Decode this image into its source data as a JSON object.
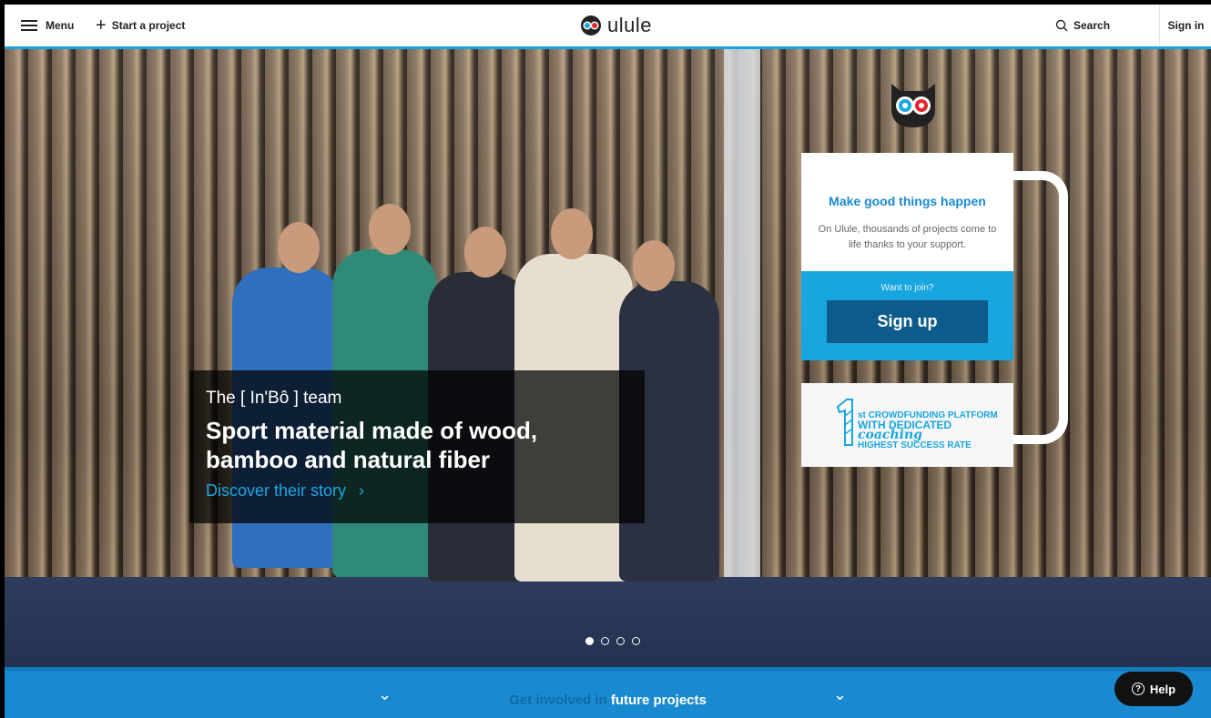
{
  "header": {
    "menu_label": "Menu",
    "start_project_label": "Start a project",
    "logo_text": "ulule",
    "search_label": "Search",
    "signin_label": "Sign in"
  },
  "hero": {
    "team": "The [ In'Bô ] team",
    "title": "Sport material made of wood, bamboo and natural fiber",
    "link": "Discover their story",
    "slides": 4,
    "active_slide": 1
  },
  "signup_card": {
    "title": "Make good things happen",
    "subtitle": "On Ulule, thousands of projects come to life thanks to your support.",
    "join_prompt": "Want to join?",
    "signup_label": "Sign up"
  },
  "badge": {
    "rank_number": "1",
    "rank_suffix": "st",
    "line1": "CROWDFUNDING PLATFORM",
    "line2_prefix": "WITH DEDICATED",
    "line2_emphasis": "coaching",
    "line3": "HIGHEST SUCCESS RATE"
  },
  "bottom_bar": {
    "muted": "Get involved in",
    "strong": "future projects"
  },
  "help_label": "Help",
  "colors": {
    "accent": "#18a5e0",
    "button_dark": "#0d5b8a",
    "bottom_bar": "#1a8ad0"
  }
}
